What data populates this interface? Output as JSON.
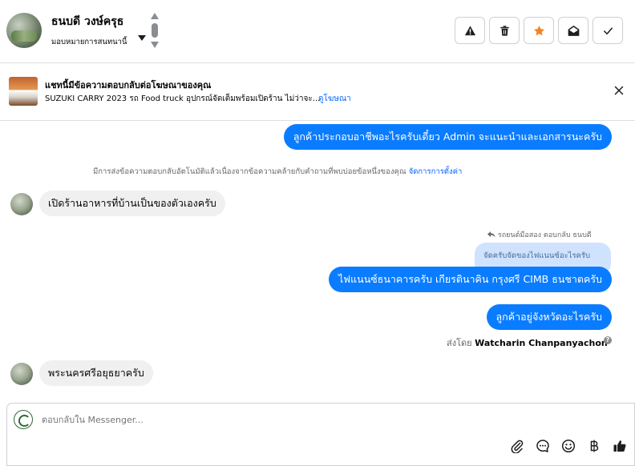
{
  "header": {
    "contact_name": "ธนบดี วงษ์ครุธ",
    "assign_label": "มอบหมายการสนทนานี้",
    "actions": [
      "spam-warning",
      "delete",
      "star",
      "mark-unread",
      "done"
    ]
  },
  "ad_banner": {
    "title": "แชทนี้มีข้อความตอบกลับต่อโฆษณาของคุณ",
    "subtitle": "SUZUKI CARRY 2023 รถ Food truck อุปกรณ์จัดเต็มพร้อมเปิดร้าน ไม่ว่าจะ...",
    "link": "ดูโฆษณา"
  },
  "messages": {
    "m1": "ลูกค้าประกอบอาชีพอะไรครับเดี๋ยว Admin จะแนะนำและเอกสารนะครับ",
    "system_note": "มีการส่งข้อความตอบกลับอัตโนมัติแล้วเนื่องจากข้อความคล้ายกับคำถามที่พบบ่อยข้อหนึ่งของคุณ",
    "system_link": "จัดการการตั้งค่า",
    "m2": "เปิดร้านอาหารที่บ้านเป็นของตัวเองครับ",
    "reply_meta": "รถยนต์มือสอง ตอบกลับ ธนบดี",
    "reply_quote": "จัดครับจัดของไฟแนนซ์อะไรครับ",
    "m3": "ไฟแนนซ์ธนาคารครับ เกียรตินาคิน กรุงศรี CIMB ธนชาตครับ",
    "m4": "ลูกค้าอยู่จังหวัดอะไรครับ",
    "sent_by_prefix": "ส่งโดย",
    "sent_by_name": "Watcharin Chanpanyachon",
    "m5": "พระนครศรีอยุธยาครับ"
  },
  "composer": {
    "placeholder": "ตอบกลับใน Messenger..."
  },
  "colors": {
    "accent": "#0a7cff",
    "link": "#0866ff",
    "incoming_bubble": "#f0f0f0",
    "reply_quote_bg": "#cfe3ff",
    "star": "#f5821f"
  }
}
